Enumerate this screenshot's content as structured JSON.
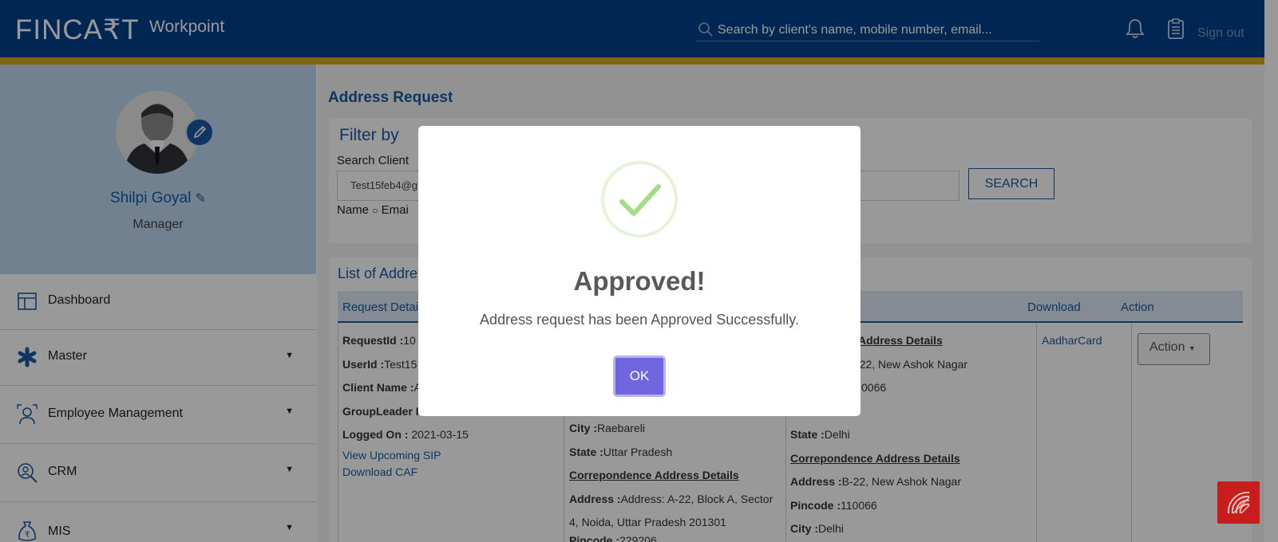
{
  "header": {
    "logo": "FINCA₹T",
    "app_name": "Workpoint",
    "search_placeholder": "Search by client's name,  mobile number, email...",
    "signout_label": "Sign out",
    "icons": [
      "search-icon",
      "bell-icon",
      "clipboard-icon"
    ]
  },
  "sidebar": {
    "user_name": "Shilpi Goyal",
    "user_role": "Manager",
    "items": [
      {
        "label": "Dashboard",
        "icon": "dashboard-icon"
      },
      {
        "label": "Master",
        "icon": "asterisk-icon",
        "caret": "▼"
      },
      {
        "label": "Employee Management",
        "icon": "employee-icon",
        "caret": "▼"
      },
      {
        "label": "CRM",
        "icon": "crm-icon",
        "caret": "▼"
      },
      {
        "label": "MIS",
        "icon": "rupee-bag-icon",
        "caret": "▼"
      }
    ]
  },
  "main": {
    "page_title": "Address Request",
    "filter": {
      "title": "Filter by",
      "search_client_label": "Search Client",
      "client_value": "Test15feb4@g",
      "radio_name": "Name",
      "radio_email": "Emai",
      "search_button": "SEARCH"
    },
    "list": {
      "title": "List of Addre",
      "headers": [
        "Request Detai",
        "Download",
        "Action"
      ],
      "col1": {
        "request_id_label": "RequestId :",
        "request_id_value": "10",
        "user_id_label": "UserId :",
        "user_id_value": "Test15",
        "client_name_label": "Client Name :",
        "client_name_value": "A",
        "group_leader_label": "GroupLeader I",
        "logged_on_label": "Logged On :",
        "logged_on_value": "2021-03-15",
        "link_sip": "View Upcoming SIP",
        "link_caf": "Download CAF"
      },
      "col2": {
        "city_label": "City :",
        "city_value": "Raebareli",
        "state_label": "State :",
        "state_value": "Uttar Pradesh",
        "corr_heading": "Correpondence Address Details",
        "address_label": "Address :",
        "address_value_1": "Address: A-22, Block A, Sector",
        "address_value_2": "4, Noida, Uttar Pradesh 201301",
        "pincode_label": "Pincode :",
        "pincode_value": "229206"
      },
      "col3": {
        "perm_heading": "Address Details",
        "perm_address": "-22, New Ashok Nagar",
        "perm_pincode": "0066",
        "state_label": "State :",
        "state_value": "Delhi",
        "corr_heading": "Correpondence Address Details",
        "address_label": "Address :",
        "address_value": "B-22, New Ashok Nagar",
        "pincode_label": "Pincode :",
        "pincode_value": "110066",
        "city_label": "City :",
        "city_value": "Delhi"
      },
      "download_link": "AadharCard",
      "action_button": "Action"
    }
  },
  "modal": {
    "title": "Approved!",
    "message": "Address request has been Approved Successfully.",
    "ok_button": "OK",
    "icon": "success-check-icon"
  },
  "colors": {
    "header_bg": "#00428a",
    "header_stripe": "#d9a81c",
    "brand_blue": "#1a5aa5",
    "ok_button": "#7066e0",
    "success_check": "#a5dc86"
  }
}
